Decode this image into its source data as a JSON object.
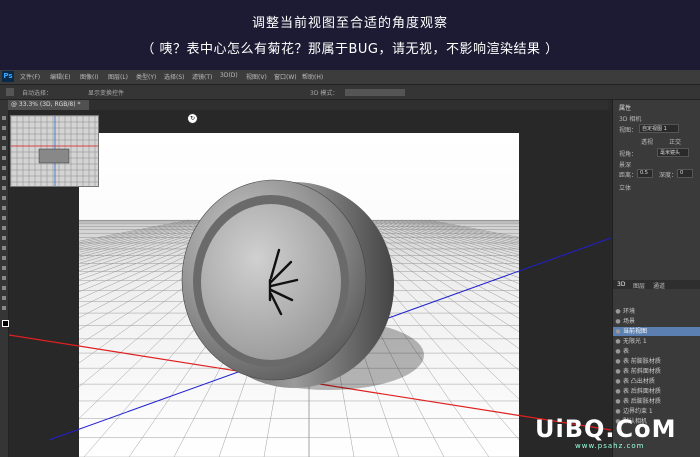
{
  "banner": {
    "line1": "调整当前视图至合适的角度观察",
    "line2": "（ 咦？表中心怎么有菊花？那属于BUG，请无视，不影响渲染结果 ）"
  },
  "app": {
    "logo": "Ps"
  },
  "menu": [
    "文件(F)",
    "编辑(E)",
    "图像(I)",
    "图层(L)",
    "类型(Y)",
    "选择(S)",
    "滤镜(T)",
    "3D(D)",
    "视图(V)",
    "窗口(W)",
    "帮助(H)"
  ],
  "options": {
    "auto_select": "自动选择：",
    "transform": "显示变换控件",
    "mode": "3D 模式："
  },
  "document_tab": "@ 33.3% (3D, RGB/8) *",
  "panel": {
    "props_title": "属性",
    "camera": "3D 相机",
    "view_label": "视图：",
    "view_value": "自定视图 1",
    "perspective": "透视",
    "ortho": "正交",
    "fov_label": "视角：",
    "fov_value": "毫米镜头",
    "dof_label": "景深",
    "distance_label": "距离：",
    "distance_value": "0.5",
    "depth_label": "深度：",
    "depth_value": "0",
    "stereo_label": "立体",
    "tabs": [
      "3D",
      "图层",
      "通道"
    ],
    "layers": [
      {
        "label": "环境",
        "selected": false
      },
      {
        "label": "场景",
        "selected": false
      },
      {
        "label": "当前视图",
        "selected": true
      },
      {
        "label": "无限光 1",
        "selected": false
      },
      {
        "label": "表",
        "selected": false
      },
      {
        "label": "表 前膨胀材质",
        "selected": false
      },
      {
        "label": "表 前斜面材质",
        "selected": false
      },
      {
        "label": "表 凸出材质",
        "selected": false
      },
      {
        "label": "表 后斜面材质",
        "selected": false
      },
      {
        "label": "表 后膨胀材质",
        "selected": false
      },
      {
        "label": "边界约束 1",
        "selected": false
      },
      {
        "label": "默认相机",
        "selected": false
      }
    ]
  },
  "watermark": {
    "main": "UiBQ.CoM",
    "sub": "www.psahz.com"
  },
  "colors": {
    "banner_bg": "#1d1b33",
    "ui_bg": "#2b2b2b",
    "accent": "#5a7fb0",
    "x_axis": "#e02020",
    "z_axis": "#2020d0"
  }
}
